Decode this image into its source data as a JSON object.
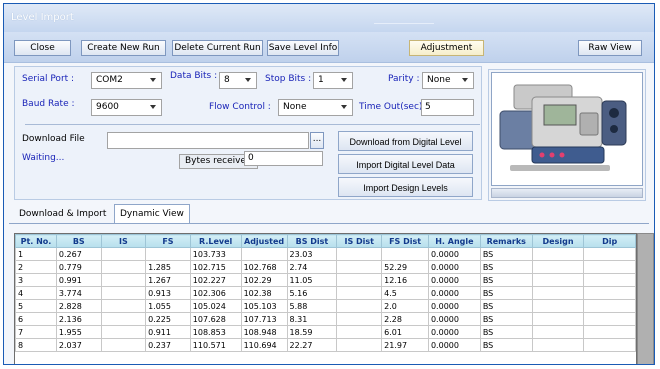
{
  "window": {
    "title": "Level Import"
  },
  "toolbar": {
    "close": "Close",
    "create_new_run": "Create New Run",
    "delete_current_run": "Delete Current Run",
    "save_level_info": "Save Level Info",
    "adjustment": "Adjustment",
    "raw_view": "Raw View"
  },
  "settings": {
    "serial_port_label": "Serial Port :",
    "serial_port_value": "COM2",
    "data_bits_label": "Data Bits :",
    "data_bits_value": "8",
    "stop_bits_label": "Stop Bits :",
    "stop_bits_value": "1",
    "parity_label": "Parity :",
    "parity_value": "None",
    "baud_rate_label": "Baud Rate :",
    "baud_rate_value": "9600",
    "flow_control_label": "Flow Control :",
    "flow_control_value": "None",
    "timeout_label": "Time Out(sec):",
    "timeout_value": "5"
  },
  "download": {
    "file_label": "Download File",
    "file_value": "",
    "browse_label": "...",
    "status": "Waiting...",
    "bytes_label": "Bytes received",
    "bytes_value": "0",
    "btn_download_digital": "Download from Digital Level",
    "btn_import_digital": "Import Digital Level Data",
    "btn_import_design": "Import Design Levels"
  },
  "tabs": [
    "Download & Import",
    "Dynamic View"
  ],
  "table": {
    "columns": [
      "Pt. No.",
      "BS",
      "IS",
      "FS",
      "R.Level",
      "Adjusted",
      "BS Dist",
      "IS Dist",
      "FS Dist",
      "H. Angle",
      "Remarks",
      "Design",
      "Dip"
    ],
    "rows": [
      [
        "1",
        "0.267",
        "",
        "",
        "103.733",
        "",
        "23.03",
        "",
        "",
        "0.0000",
        "BS",
        "",
        ""
      ],
      [
        "2",
        "0.779",
        "",
        "1.285",
        "102.715",
        "102.768",
        "2.74",
        "",
        "52.29",
        "0.0000",
        "BS",
        "",
        ""
      ],
      [
        "3",
        "0.991",
        "",
        "1.267",
        "102.227",
        "102.29",
        "11.05",
        "",
        "12.16",
        "0.0000",
        "BS",
        "",
        ""
      ],
      [
        "4",
        "3.774",
        "",
        "0.913",
        "102.306",
        "102.38",
        "5.16",
        "",
        "4.5",
        "0.0000",
        "BS",
        "",
        ""
      ],
      [
        "5",
        "2.828",
        "",
        "1.055",
        "105.024",
        "105.103",
        "5.88",
        "",
        "2.0",
        "0.0000",
        "BS",
        "",
        ""
      ],
      [
        "6",
        "2.136",
        "",
        "0.225",
        "107.628",
        "107.713",
        "8.31",
        "",
        "2.28",
        "0.0000",
        "BS",
        "",
        ""
      ],
      [
        "7",
        "1.955",
        "",
        "0.911",
        "108.853",
        "108.948",
        "18.59",
        "",
        "6.01",
        "0.0000",
        "BS",
        "",
        ""
      ],
      [
        "8",
        "2.037",
        "",
        "0.237",
        "110.571",
        "110.694",
        "22.27",
        "",
        "21.97",
        "0.0000",
        "BS",
        "",
        ""
      ]
    ]
  },
  "image": {
    "subject": "digital-level-instrument"
  }
}
